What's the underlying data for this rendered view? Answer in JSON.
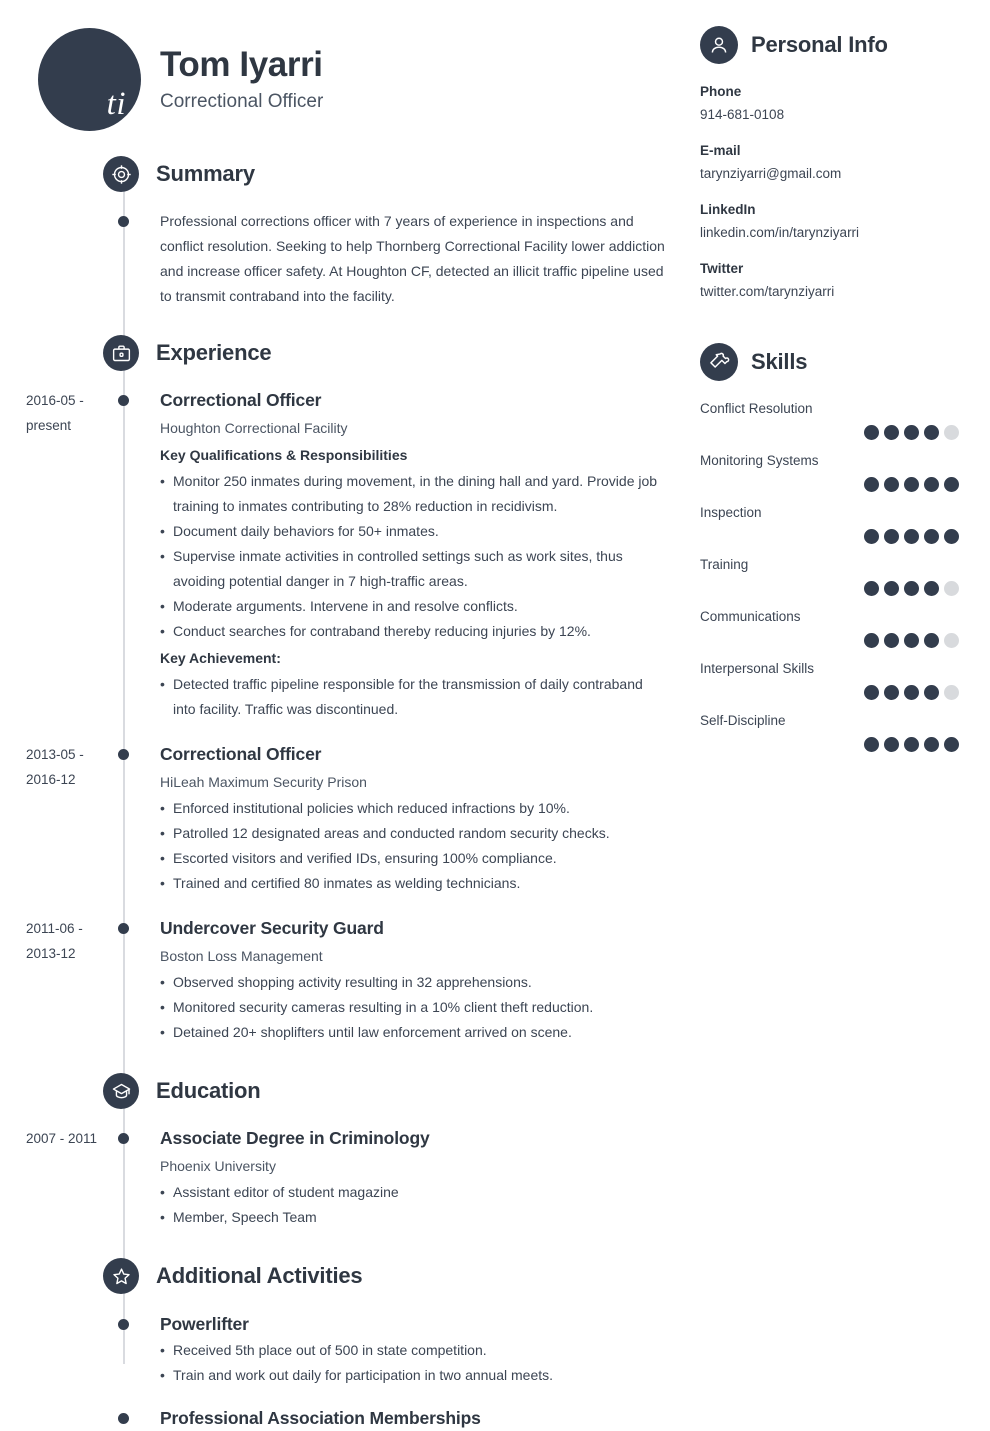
{
  "theme": {
    "accent_dark": "#333d4d",
    "text": "#3c4553",
    "heading": "#2f3742",
    "rail": "#d9dbe0",
    "dot_off": "#d8dadd"
  },
  "header": {
    "initials": "ti",
    "name": "Tom Iyarri",
    "job_title": "Correctional Officer"
  },
  "summary": {
    "icon": "target-icon",
    "title": "Summary",
    "text": "Professional corrections officer with 7 years of experience in inspections and conflict resolution. Seeking to help Thornberg Correctional Facility lower addiction and increase officer safety. At Houghton CF, detected an illicit traffic pipeline used to transmit contraband into the facility."
  },
  "experience": {
    "icon": "briefcase-icon",
    "title": "Experience",
    "entries": [
      {
        "date": "2016-05 - present",
        "title": "Correctional Officer",
        "org": "Houghton Correctional Facility",
        "sub1": "Key Qualifications & Responsibilities",
        "bullets1": [
          "Monitor 250 inmates during movement, in the dining hall and yard. Provide job training to inmates contributing to 28% reduction in recidivism.",
          "Document daily behaviors for 50+ inmates.",
          "Supervise inmate activities in controlled settings such as work sites, thus avoiding potential danger in 7 high-traffic areas.",
          "Moderate arguments. Intervene in and resolve conflicts.",
          "Conduct searches for contraband thereby reducing injuries by 12%."
        ],
        "sub2": "Key Achievement:",
        "bullets2": [
          "Detected traffic pipeline responsible for the transmission of daily contraband into facility. Traffic was discontinued."
        ]
      },
      {
        "date": "2013-05 - 2016-12",
        "title": "Correctional Officer",
        "org": "HiLeah Maximum Security Prison",
        "bullets1": [
          "Enforced institutional policies which reduced infractions by 10%.",
          "Patrolled 12 designated areas and conducted random security checks.",
          "Escorted visitors and verified IDs, ensuring 100% compliance.",
          "Trained and certified 80 inmates as welding technicians."
        ]
      },
      {
        "date": "2011-06 - 2013-12",
        "title": "Undercover Security Guard",
        "org": "Boston Loss Management",
        "bullets1": [
          "Observed shopping activity resulting in 32 apprehensions.",
          "Monitored security cameras resulting in a 10% client theft reduction.",
          "Detained 20+ shoplifters until law enforcement arrived on scene."
        ]
      }
    ]
  },
  "education": {
    "icon": "graduation-cap-icon",
    "title": "Education",
    "entries": [
      {
        "date": "2007 - 2011",
        "title": "Associate Degree in Criminology",
        "org": "Phoenix University",
        "bullets1": [
          "Assistant editor of student magazine",
          "Member, Speech Team"
        ]
      }
    ]
  },
  "additional_activities": {
    "icon": "star-icon",
    "title": "Additional Activities",
    "entries": [
      {
        "title": "Powerlifter",
        "bullets1": [
          "Received 5th place out of 500 in state competition.",
          "Train and work out daily for participation in two annual meets."
        ]
      },
      {
        "title": "Professional Association Memberships",
        "bullets1": []
      }
    ]
  },
  "personal_info": {
    "icon": "person-icon",
    "title": "Personal Info",
    "items": [
      {
        "label": "Phone",
        "value": "914-681-0108"
      },
      {
        "label": "E-mail",
        "value": "tarynziyarri@gmail.com"
      },
      {
        "label": "LinkedIn",
        "value": "linkedin.com/in/tarynziyarri"
      },
      {
        "label": "Twitter",
        "value": "twitter.com/tarynziyarri"
      }
    ]
  },
  "skills": {
    "icon": "puzzle-piece-icon",
    "title": "Skills",
    "max_rating": 5,
    "items": [
      {
        "name": "Conflict Resolution",
        "rating": 4
      },
      {
        "name": "Monitoring Systems",
        "rating": 5
      },
      {
        "name": "Inspection",
        "rating": 5
      },
      {
        "name": "Training",
        "rating": 4
      },
      {
        "name": "Communications",
        "rating": 4
      },
      {
        "name": "Interpersonal Skills",
        "rating": 4
      },
      {
        "name": "Self-Discipline",
        "rating": 5
      }
    ]
  }
}
